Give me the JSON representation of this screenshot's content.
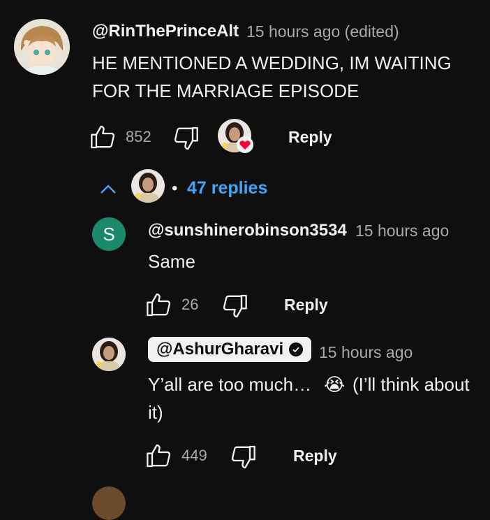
{
  "comment": {
    "username": "@RinThePrinceAlt",
    "time": "15 hours ago (edited)",
    "text_line1": "HE MENTIONED A WEDDING, IM WAITING",
    "text_line2": "FOR THE MARRIAGE EPISODE",
    "likes": "852",
    "reply_label": "Reply"
  },
  "replies_toggle": {
    "bullet": "•",
    "label": "47 replies",
    "accent": "#3ea6ff"
  },
  "replies": [
    {
      "avatar_letter": "S",
      "username": "@sunshinerobinson3534",
      "time": "15 hours ago",
      "text": "Same",
      "likes": "26",
      "reply_label": "Reply"
    },
    {
      "username": "@AshurGharavi",
      "time": "15 hours ago",
      "text_line1": "Y’all are too much…",
      "emoji": "😭",
      "text_line1_end": "(I’ll think about",
      "text_line2": "it)",
      "likes": "449",
      "reply_label": "Reply"
    }
  ]
}
